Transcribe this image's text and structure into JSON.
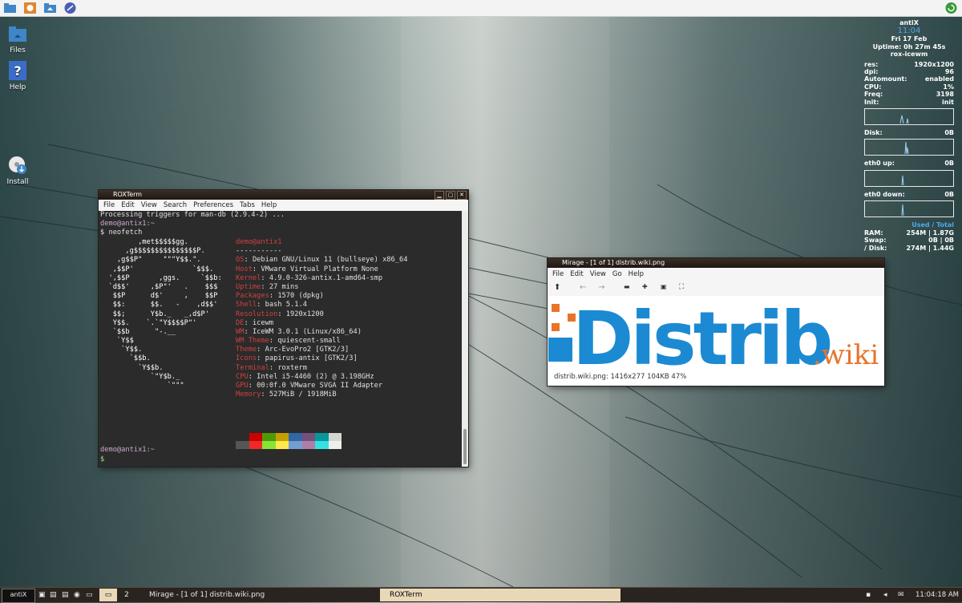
{
  "top_panel": {
    "launchers": [
      "files-icon",
      "spreadsheet-icon",
      "home-folder-icon",
      "browser-icon"
    ],
    "update_icon": "refresh-icon"
  },
  "desktop": {
    "icons": [
      {
        "label": "Files",
        "icon": "folder-icon"
      },
      {
        "label": "Help",
        "icon": "help-icon"
      },
      {
        "label": "Install",
        "icon": "install-icon"
      }
    ]
  },
  "conky": {
    "host": "antiX",
    "time": "11:04",
    "date": "Fri 17 Feb",
    "uptime": "Uptime: 0h 27m 45s",
    "wm": "rox-icewm",
    "rows": [
      {
        "k": "res:",
        "v": "1920x1200"
      },
      {
        "k": "dpi:",
        "v": "96"
      },
      {
        "k": "Automount:",
        "v": "enabled"
      },
      {
        "k": "CPU:",
        "v": "1%"
      },
      {
        "k": "Freq:",
        "v": "3198"
      },
      {
        "k": "Init:",
        "v": "init"
      }
    ],
    "disk": {
      "k": "Disk:",
      "v": "0B"
    },
    "eth0_up": {
      "k": "eth0 up:",
      "v": "0B"
    },
    "eth0_down": {
      "k": "eth0 down:",
      "v": "0B"
    },
    "used_total": "Used / Total",
    "mem": [
      {
        "k": "RAM:",
        "v": "254M | 1.87G"
      },
      {
        "k": "Swap:",
        "v": "0B | 0B"
      },
      {
        "k": "/ Disk:",
        "v": "274M | 1.44G"
      }
    ]
  },
  "terminal": {
    "title": "ROXTerm",
    "menu": [
      "File",
      "Edit",
      "View",
      "Search",
      "Preferences",
      "Tabs",
      "Help"
    ],
    "line1": "Processing triggers for man-db (2.9.4-2) ...",
    "prompt_user": "demo@antix1:~",
    "cmd": "$ neofetch",
    "art": [
      "         ,met$$$$$gg.",
      "      ,g$$$$$$$$$$$$$$$P.",
      "    ,g$$P\"     \"\"\"Y$$.\".",
      "   ,$$P'              `$$$.",
      "  ',$$P       ,ggs.     `$$b:",
      "  `d$$'     ,$P\"'   .    $$$",
      "   $$P      d$'     ,    $$P",
      "   $$:      $$.   -    ,d$$'",
      "   $$;      Y$b._   _,d$P'",
      "   Y$$.    `.`\"Y$$$$P\"'",
      "   `$$b      \"-.__",
      "    `Y$$",
      "     `Y$$.",
      "       `$$b.",
      "         `Y$$b.",
      "            `\"Y$b._",
      "                `\"\"\""
    ],
    "info_user": "demo@antix1",
    "info_sep": "-----------",
    "info": [
      {
        "k": "OS",
        "v": "Debian GNU/Linux 11 (bullseye) x86_64"
      },
      {
        "k": "Host",
        "v": "VMware Virtual Platform None"
      },
      {
        "k": "Kernel",
        "v": "4.9.0-326-antix.1-amd64-smp"
      },
      {
        "k": "Uptime",
        "v": "27 mins"
      },
      {
        "k": "Packages",
        "v": "1570 (dpkg)"
      },
      {
        "k": "Shell",
        "v": "bash 5.1.4"
      },
      {
        "k": "Resolution",
        "v": "1920x1200"
      },
      {
        "k": "DE",
        "v": "icewm"
      },
      {
        "k": "WM",
        "v": "IceWM 3.0.1 (Linux/x86_64)"
      },
      {
        "k": "WM Theme",
        "v": "quiescent-small"
      },
      {
        "k": "Theme",
        "v": "Arc-EvoPro2 [GTK2/3]"
      },
      {
        "k": "Icons",
        "v": "papirus-antix [GTK2/3]"
      },
      {
        "k": "Terminal",
        "v": "roxterm"
      },
      {
        "k": "CPU",
        "v": "Intel i5-4460 (2) @ 3.198GHz"
      },
      {
        "k": "GPU",
        "v": "00:0f.0 VMware SVGA II Adapter"
      },
      {
        "k": "Memory",
        "v": "527MiB / 1918MiB"
      }
    ],
    "colors_dark": [
      "#2b2b2b",
      "#cc0000",
      "#4e9a06",
      "#c4a000",
      "#3465a4",
      "#75507b",
      "#06989a",
      "#d3d7cf"
    ],
    "colors_bright": [
      "#555753",
      "#ef2929",
      "#8ae234",
      "#fce94f",
      "#729fcf",
      "#ad7fa8",
      "#34e2e2",
      "#eeeeec"
    ],
    "end_prompt": "demo@antix1:~",
    "end_cursor": "$"
  },
  "mirage": {
    "title": "Mirage - [1 of 1] distrib.wiki.png",
    "menu": [
      "File",
      "Edit",
      "View",
      "Go",
      "Help"
    ],
    "logo_text": "Distrib",
    "logo_suffix": ".wiki",
    "status": "distrib.wiki.png:  1416x277   104KB   47%",
    "brand_blue": "#1b8ad3",
    "brand_orange": "#e8742a"
  },
  "taskbar": {
    "start": "antiX",
    "workspace": "2",
    "tasks": [
      {
        "label": "Mirage - [1 of 1] distrib.wiki.png"
      },
      {
        "label": "ROXTerm"
      }
    ],
    "clock": "11:04:18 AM"
  }
}
